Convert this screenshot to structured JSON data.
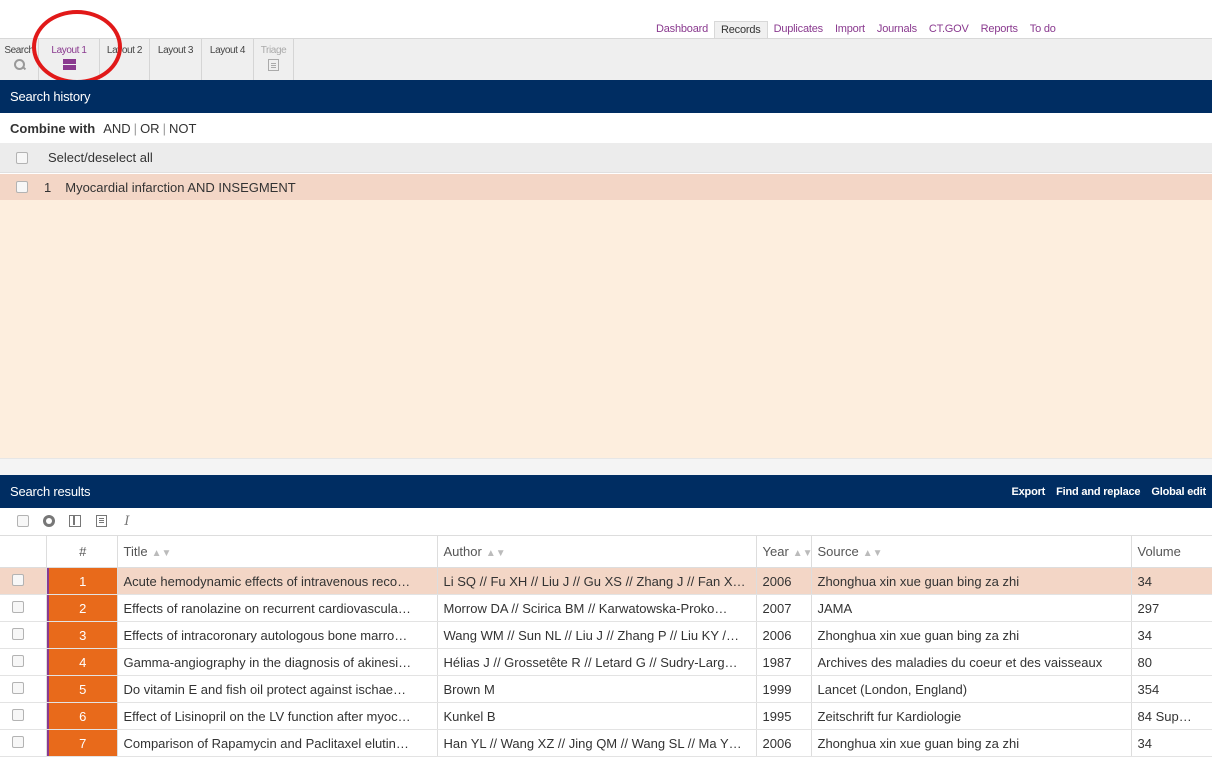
{
  "top_nav": {
    "items": [
      {
        "label": "Dashboard",
        "active": false
      },
      {
        "label": "Records",
        "active": true
      },
      {
        "label": "Duplicates",
        "active": false
      },
      {
        "label": "Import",
        "active": false
      },
      {
        "label": "Journals",
        "active": false
      },
      {
        "label": "CT.GOV",
        "active": false
      },
      {
        "label": "Reports",
        "active": false
      },
      {
        "label": "To do",
        "active": false
      }
    ]
  },
  "toolbar": {
    "search": "Search",
    "layout1": "Layout 1",
    "layout2": "Layout 2",
    "layout3": "Layout 3",
    "layout4": "Layout 4",
    "triage": "Triage"
  },
  "colors": {
    "brand_purple": "#8a3a8f",
    "header_navy": "#002d62",
    "row_number_orange": "#e86a1b",
    "highlight_peach": "#f3d6c6",
    "annotation_red": "#e11919"
  },
  "search_history": {
    "title": "Search history",
    "combine_label": "Combine with",
    "ops": [
      "AND",
      "OR",
      "NOT"
    ],
    "select_all": "Select/deselect all",
    "entries": [
      {
        "number": "1",
        "query": "Myocardial infarction AND INSEGMENT"
      }
    ]
  },
  "search_results": {
    "title": "Search results",
    "actions": [
      "Export",
      "Find and replace",
      "Global edit"
    ],
    "icons": [
      "checkbox-icon",
      "gear-icon",
      "columns-icon",
      "note-icon",
      "pen-icon"
    ],
    "columns": {
      "num": "#",
      "title": "Title",
      "author": "Author",
      "year": "Year",
      "source": "Source",
      "volume": "Volume"
    },
    "rows": [
      {
        "num": "1",
        "title": "Acute hemodynamic effects of intravenous reco…",
        "author": "Li SQ // Fu XH // Liu J // Gu XS // Zhang J // Fan X…",
        "year": "2006",
        "source": "Zhonghua xin xue guan bing za zhi",
        "volume": "34"
      },
      {
        "num": "2",
        "title": "Effects of ranolazine on recurrent cardiovascula…",
        "author": "Morrow DA // Scirica BM // Karwatowska-Proko…",
        "year": "2007",
        "source": "JAMA",
        "volume": "297"
      },
      {
        "num": "3",
        "title": "Effects of intracoronary autologous bone marro…",
        "author": "Wang WM // Sun NL // Liu J // Zhang P // Liu KY /…",
        "year": "2006",
        "source": "Zhonghua xin xue guan bing za zhi",
        "volume": "34"
      },
      {
        "num": "4",
        "title": "Gamma-angiography in the diagnosis of akinesi…",
        "author": "Hélias J // Grossetête R // Letard G // Sudry-Larg…",
        "year": "1987",
        "source": "Archives des maladies du coeur et des vaisseaux",
        "volume": "80"
      },
      {
        "num": "5",
        "title": "Do vitamin E and fish oil protect against ischae…",
        "author": "Brown M",
        "year": "1999",
        "source": "Lancet (London, England)",
        "volume": "354"
      },
      {
        "num": "6",
        "title": "Effect of Lisinopril on the LV function after myoc…",
        "author": "Kunkel B",
        "year": "1995",
        "source": "Zeitschrift fur Kardiologie",
        "volume": "84 Sup…"
      },
      {
        "num": "7",
        "title": "Comparison of Rapamycin and Paclitaxel elutin…",
        "author": "Han YL // Wang XZ // Jing QM // Wang SL // Ma Y…",
        "year": "2006",
        "source": "Zhonghua xin xue guan bing za zhi",
        "volume": "34"
      }
    ]
  }
}
